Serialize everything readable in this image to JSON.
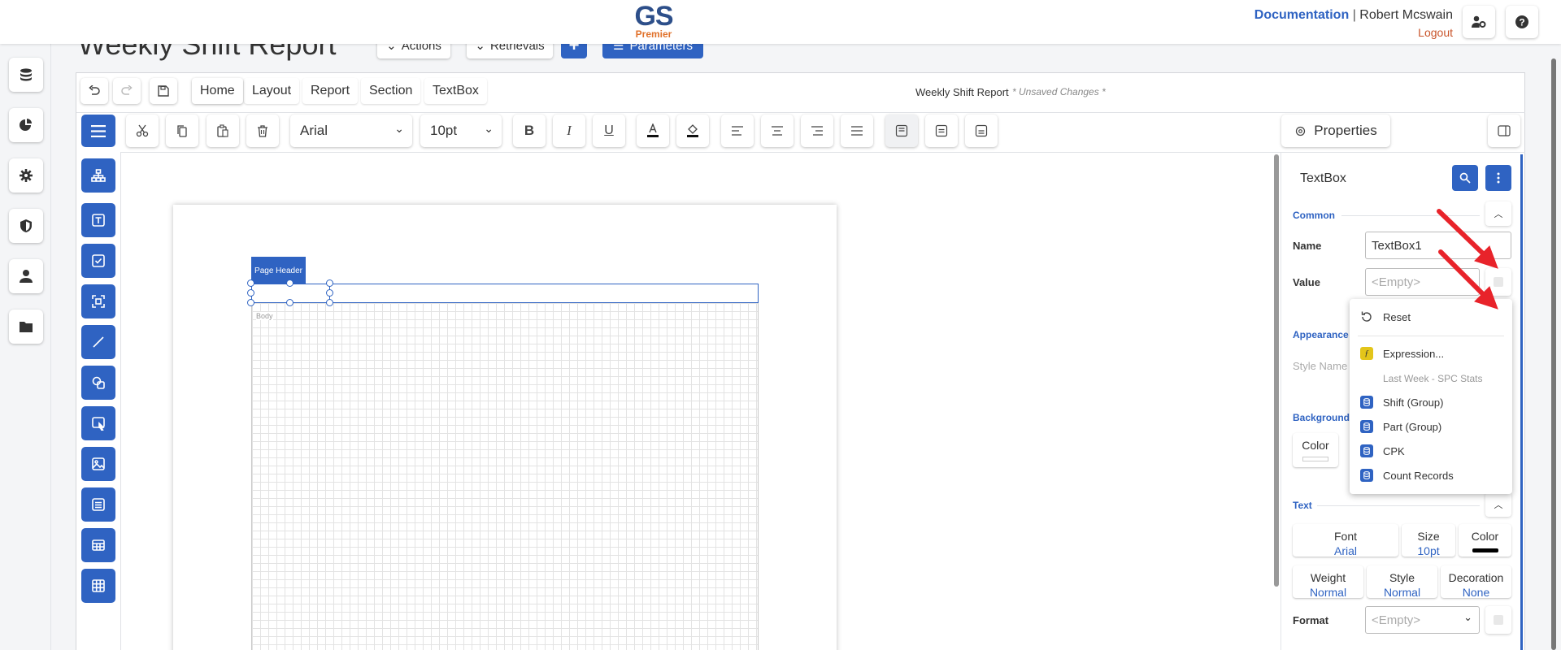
{
  "header": {
    "logo_text": "GS",
    "logo_sub": "Premier",
    "documentation_link": "Documentation",
    "separator": "|",
    "user_name": "Robert Mcswain",
    "logout_link": "Logout"
  },
  "page": {
    "title": "Weekly Shift Report",
    "actions_label": "Actions",
    "retrievals_label": "Retrievals",
    "add_label": "+",
    "parameters_label": "Parameters"
  },
  "tabs": [
    "Home",
    "Layout",
    "Report",
    "Section",
    "TextBox"
  ],
  "designer": {
    "report_name": "Weekly Shift Report",
    "unsaved": "* Unsaved Changes *",
    "font_family": "Arial",
    "font_size": "10pt",
    "properties_label": "Properties"
  },
  "canvas": {
    "page_header_label": "Page Header",
    "body_label": "Body"
  },
  "properties": {
    "panel_title": "TextBox",
    "common_label": "Common",
    "name_label": "Name",
    "name_value": "TextBox1",
    "value_label": "Value",
    "value_placeholder": "<Empty>",
    "appearance_label": "Appearance",
    "style_name_label": "Style Name",
    "background_label": "Background",
    "bg_color_label": "Color",
    "text_label": "Text",
    "font_label": "Font",
    "font_value": "Arial",
    "size_label": "Size",
    "size_value": "10pt",
    "color_label": "Color",
    "weight_label": "Weight",
    "weight_value": "Normal",
    "style_label": "Style",
    "style_value": "Normal",
    "decoration_label": "Decoration",
    "decoration_value": "None",
    "format_label": "Format",
    "format_placeholder": "<Empty>"
  },
  "value_menu": {
    "reset": "Reset",
    "expression": "Expression...",
    "group_header": "Last Week - SPC Stats",
    "fields": [
      "Shift (Group)",
      "Part (Group)",
      "CPK",
      "Count Records"
    ]
  },
  "colors": {
    "accent": "#2f63c2",
    "logout": "#c9542a",
    "logo_gs": "#2d4f8a",
    "logo_premier": "#e0712a",
    "arrow": "#e8232a"
  }
}
